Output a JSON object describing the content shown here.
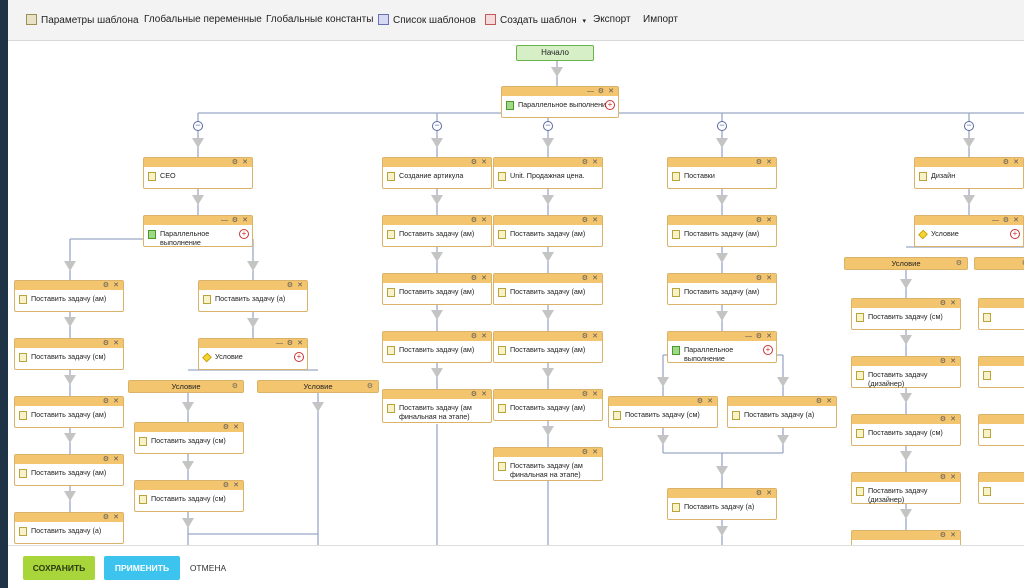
{
  "toolbar": {
    "items": [
      {
        "label": "Параметры шаблона",
        "icon": "settings-icon"
      },
      {
        "label": "Глобальные переменные"
      },
      {
        "label": "Глобальные константы"
      },
      {
        "label": "Список шаблонов",
        "icon": "list-icon"
      },
      {
        "label": "Создать шаблон",
        "icon": "create-icon"
      },
      {
        "label": "Экспорт"
      },
      {
        "label": "Импорт"
      }
    ]
  },
  "diagram": {
    "start": "Начало",
    "parallel": "Параллельное выполнение",
    "condition": "Условие",
    "branches": {
      "ceo": "CEO",
      "article": "Создание артикула",
      "unit": "Unit. Продажная цена.",
      "supply": "Поставки",
      "design": "Дизайн"
    },
    "tasks": {
      "am": "Поставить задачу (ам)",
      "sm": "Поставить задачу (см)",
      "a": "Поставить задачу (а)",
      "am_final": "Поставить задачу (ам финальная на этапе)",
      "designer": "Поставить задачу (дизайнер)"
    }
  },
  "footer": {
    "save": "СОХРАНИТЬ",
    "apply": "ПРИМЕНИТЬ",
    "cancel": "ОТМЕНА"
  },
  "colors": {
    "block_header": "#f4c56f",
    "save_button": "#a8d63a",
    "apply_button": "#3cc3ee",
    "start_fill": "#d6efc7"
  }
}
